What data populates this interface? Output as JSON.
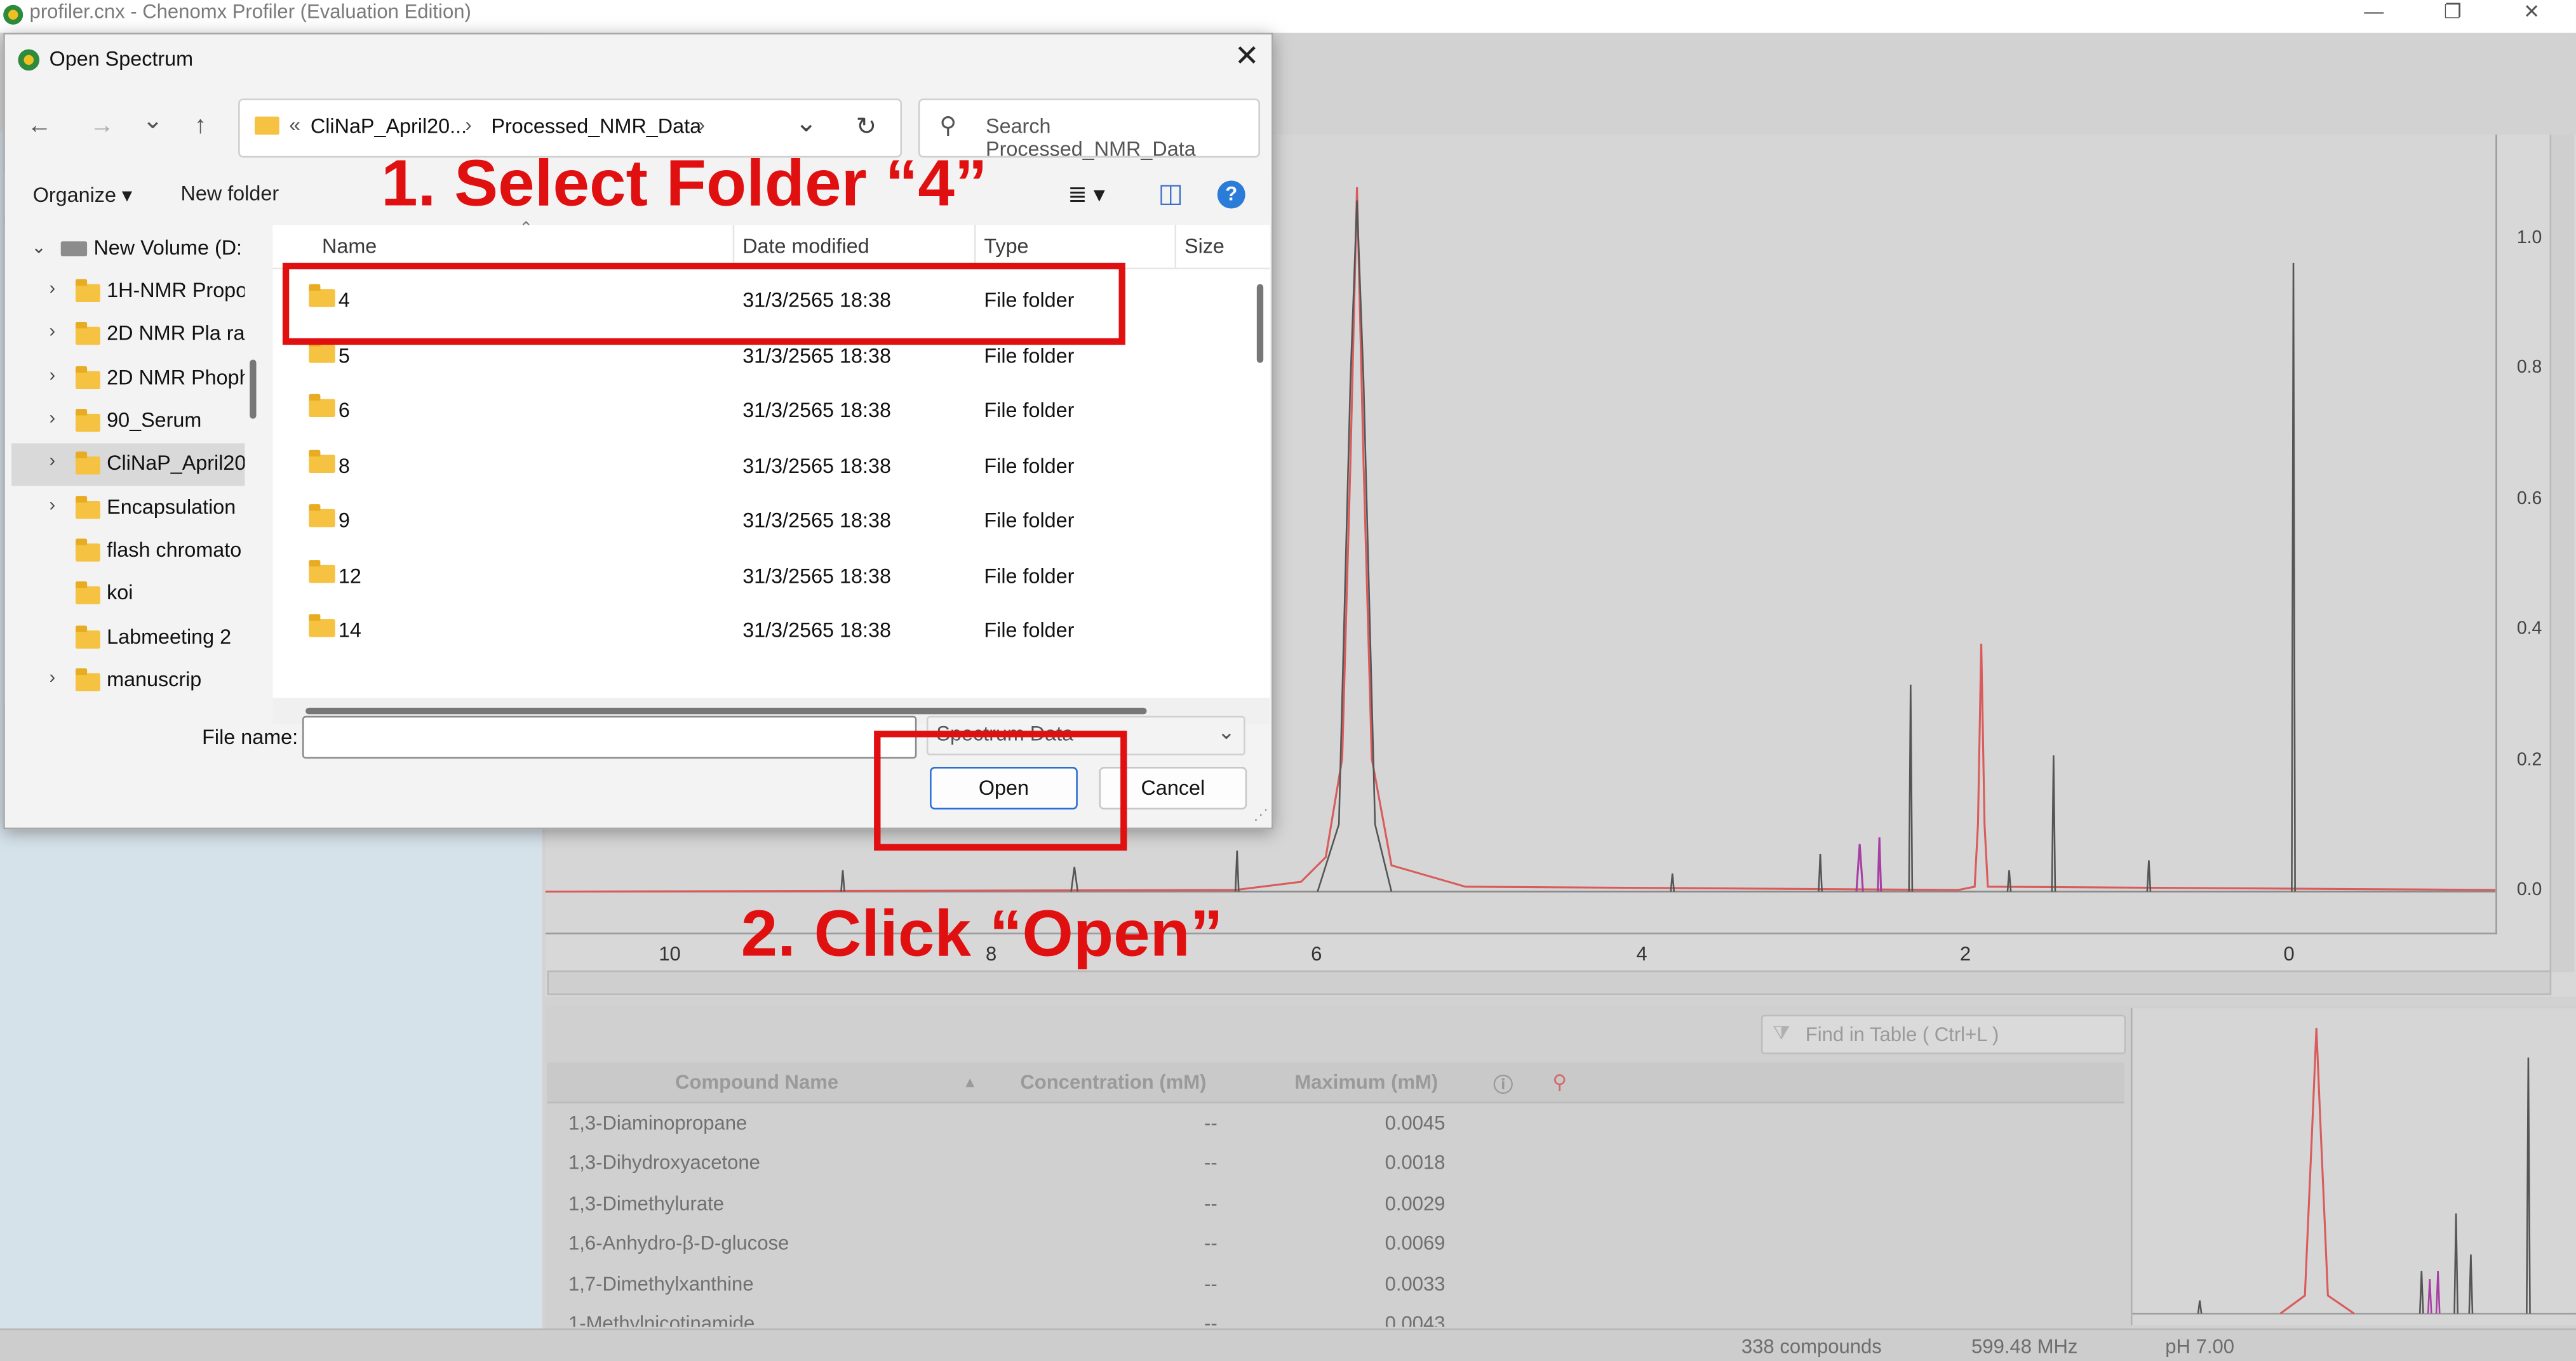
{
  "window": {
    "title": "profiler.cnx - Chenomx Profiler (Evaluation Edition)",
    "minimize": "—",
    "restore": "❐",
    "close": "✕"
  },
  "spectrum": {
    "y_ticks": [
      "1.0",
      "0.8",
      "0.6",
      "0.4",
      "0.2",
      "0.0"
    ],
    "x_ticks": [
      "10",
      "8",
      "6",
      "4",
      "2",
      "0"
    ]
  },
  "compounds": {
    "find_placeholder": "Find in Table ( Ctrl+L )",
    "columns": [
      "Compound Name",
      "Concentration (mM)",
      "Maximum (mM)"
    ],
    "rows": [
      {
        "name": "1,3-Diaminopropane",
        "conc": "--",
        "max": "0.0045"
      },
      {
        "name": "1,3-Dihydroxyacetone",
        "conc": "--",
        "max": "0.0018"
      },
      {
        "name": "1,3-Dimethylurate",
        "conc": "--",
        "max": "0.0029"
      },
      {
        "name": "1,6-Anhydro-β-D-glucose",
        "conc": "--",
        "max": "0.0069"
      },
      {
        "name": "1,7-Dimethylxanthine",
        "conc": "--",
        "max": "0.0033"
      },
      {
        "name": "1-Methylnicotinamide",
        "conc": "--",
        "max": "0.0043"
      }
    ]
  },
  "status": {
    "compounds": "338 compounds",
    "freq": "599.48 MHz",
    "ph": "pH 7.00"
  },
  "dialog": {
    "title": "Open Spectrum",
    "close": "✕",
    "nav": {
      "back": "←",
      "forward": "→",
      "recent": "⌄",
      "up": "↑"
    },
    "address": {
      "overflow": "«",
      "seg1": "CliNaP_April20...",
      "sep1": "›",
      "seg2": "Processed_NMR_Data",
      "sep2": "›",
      "dropdown": "⌄",
      "refresh": "↻"
    },
    "search_placeholder": "Search Processed_NMR_Data",
    "toolbar": {
      "organize": "Organize ▾",
      "new_folder": "New folder",
      "view": "≣ ▾",
      "pane": "◫",
      "help": "?"
    },
    "tree": [
      {
        "label": "New Volume (D:",
        "chev": "⌄",
        "icon": "drive"
      },
      {
        "label": "1H-NMR Propo",
        "chev": "›",
        "icon": "folder"
      },
      {
        "label": "2D NMR  Pla ra",
        "chev": "›",
        "icon": "folder"
      },
      {
        "label": "2D NMR Phoph",
        "chev": "›",
        "icon": "folder"
      },
      {
        "label": "90_Serum",
        "chev": "›",
        "icon": "folder"
      },
      {
        "label": "CliNaP_April20",
        "chev": "›",
        "icon": "folder"
      },
      {
        "label": "Encapsulation",
        "chev": "›",
        "icon": "folder"
      },
      {
        "label": "flash chromato",
        "chev": "",
        "icon": "folder"
      },
      {
        "label": "koi",
        "chev": "",
        "icon": "folder"
      },
      {
        "label": "Labmeeting  2",
        "chev": "",
        "icon": "folder"
      },
      {
        "label": "manuscrip",
        "chev": "›",
        "icon": "folder"
      }
    ],
    "columns": {
      "name": "Name",
      "date": "Date modified",
      "type": "Type",
      "size": "Size"
    },
    "files": [
      {
        "name": "4",
        "date": "31/3/2565 18:38",
        "type": "File folder"
      },
      {
        "name": "5",
        "date": "31/3/2565 18:38",
        "type": "File folder"
      },
      {
        "name": "6",
        "date": "31/3/2565 18:38",
        "type": "File folder"
      },
      {
        "name": "8",
        "date": "31/3/2565 18:38",
        "type": "File folder"
      },
      {
        "name": "9",
        "date": "31/3/2565 18:38",
        "type": "File folder"
      },
      {
        "name": "12",
        "date": "31/3/2565 18:38",
        "type": "File folder"
      },
      {
        "name": "14",
        "date": "31/3/2565 18:38",
        "type": "File folder"
      }
    ],
    "file_name_label": "File name:",
    "file_name_value": "",
    "file_type": "Spectrum Data",
    "open_label": "Open",
    "cancel_label": "Cancel"
  },
  "annotations": {
    "step1": "1. Select Folder “4”",
    "step2": "2. Click “Open”",
    "color": "#e01010"
  }
}
